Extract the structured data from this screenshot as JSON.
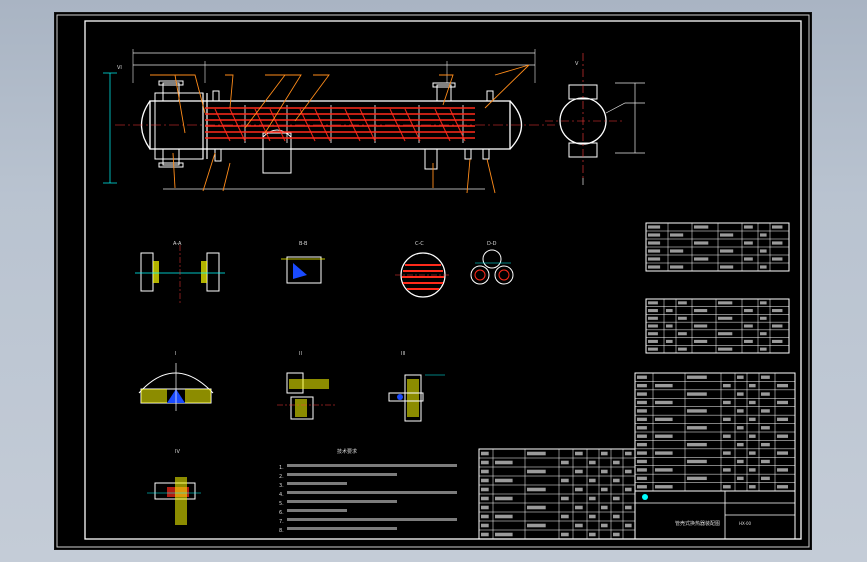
{
  "drawing": {
    "note_heading": "技术要求",
    "section_labels": [
      "A-A",
      "B-B",
      "C-C",
      "D-D",
      "I",
      "II",
      "III",
      "IV",
      "V",
      "VI"
    ],
    "title_block_text": "管壳式换热器装配图",
    "drawing_number": "HX-00",
    "notes": [
      "1.",
      "2.",
      "3.",
      "4.",
      "5.",
      "6.",
      "7.",
      "8."
    ],
    "colors": {
      "background": "#000000",
      "frame": "#ffffff",
      "tubes": "#ff2a1a",
      "dimensions": "#00ffff",
      "leaders": "#ff8c1a",
      "hatch": "#ffff00",
      "weld": "#1a4bff"
    }
  }
}
